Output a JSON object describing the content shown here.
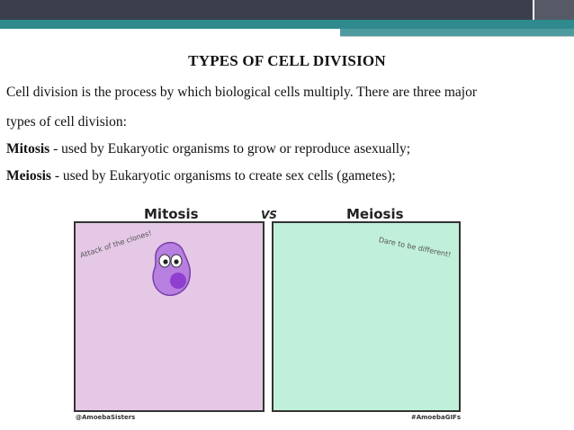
{
  "slide": {
    "title": "TYPES OF CELL DIVISION",
    "intro_line1": "Cell division is the process by which biological cells multiply. There are three major",
    "intro_line2": "types of cell division:",
    "items": [
      {
        "term": "Mitosis",
        "text": " - used by Eukaryotic organisms to grow or reproduce asexually;"
      },
      {
        "term": "Meiosis",
        "text": " - used by Eukaryotic organisms to create sex cells (gametes);"
      }
    ]
  },
  "comic": {
    "left_title": "Mitosis",
    "vs": "VS",
    "right_title": "Meiosis",
    "left_note": "Attack of the clones!",
    "right_note": "Dare to be different!",
    "credit_left": "@AmoebaSisters",
    "credit_right": "#AmoebaGIFs",
    "colors": {
      "left_panel": "#e4c8e6",
      "right_panel": "#c1f0da",
      "amoeba": "#b77fe0"
    }
  }
}
